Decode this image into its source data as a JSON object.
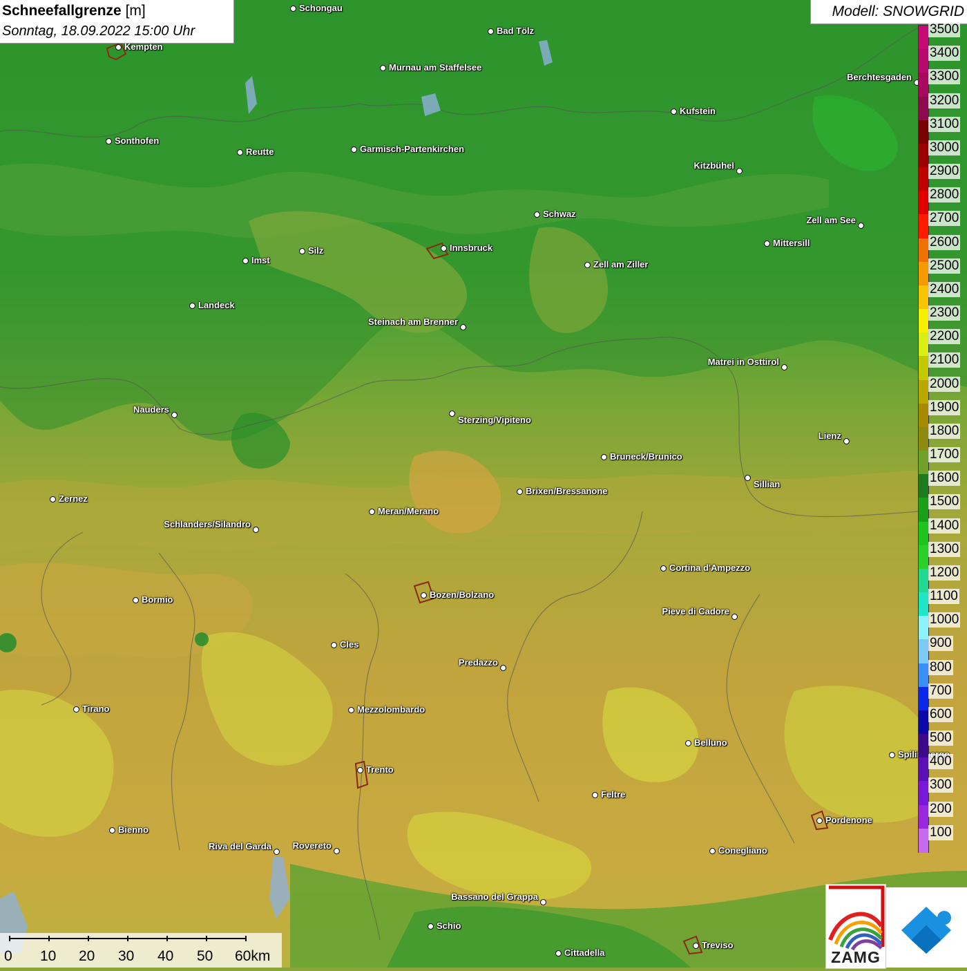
{
  "header": {
    "title_bold": "Schneefallgrenze",
    "title_unit": " [m]",
    "datetime": "Sonntag, 18.09.2022 15:00 Uhr",
    "model": "Modell: SNOWGRID"
  },
  "legend": {
    "levels": [
      "3500",
      "3400",
      "3300",
      "3200",
      "3100",
      "3000",
      "2900",
      "2800",
      "2700",
      "2600",
      "2500",
      "2400",
      "2300",
      "2200",
      "2100",
      "2000",
      "1900",
      "1800",
      "1700",
      "1600",
      "1500",
      "1400",
      "1300",
      "1200",
      "1100",
      "1000",
      "900",
      "800",
      "700",
      "600",
      "500",
      "400",
      "300",
      "200",
      "100"
    ],
    "colors": [
      "#c40a74",
      "#b80a6e",
      "#a8085e",
      "#8e0a4c",
      "#7a0000",
      "#9c0000",
      "#c00000",
      "#e00000",
      "#ff1a00",
      "#f07000",
      "#f59a00",
      "#f8c400",
      "#f6f000",
      "#d8ee14",
      "#c4c800",
      "#b8a800",
      "#a88a00",
      "#8e8a10",
      "#6ea02a",
      "#1e7a1e",
      "#18a018",
      "#1ec41e",
      "#2ad02a",
      "#20d890",
      "#20e6c8",
      "#8ef2ff",
      "#7ec8f8",
      "#3a8ef8",
      "#0a28e8",
      "#0a0aa8",
      "#3a0a8a",
      "#5a10b4",
      "#7a18d8",
      "#9a28e0",
      "#c86af0"
    ]
  },
  "cities": [
    {
      "name": "Schongau"
    },
    {
      "name": "Bad Tölz"
    },
    {
      "name": "Kempten"
    },
    {
      "name": "Murnau am Staffelsee"
    },
    {
      "name": "Berchtesgaden"
    },
    {
      "name": "Kufstein"
    },
    {
      "name": "Sonthofen"
    },
    {
      "name": "Reutte"
    },
    {
      "name": "Garmisch-Partenkirchen"
    },
    {
      "name": "Kitzbühel"
    },
    {
      "name": "Schwaz"
    },
    {
      "name": "Zell am See"
    },
    {
      "name": "Innsbruck"
    },
    {
      "name": "Mittersill"
    },
    {
      "name": "Imst"
    },
    {
      "name": "Silz"
    },
    {
      "name": "Zell am Ziller"
    },
    {
      "name": "Landeck"
    },
    {
      "name": "Steinach am Brenner"
    },
    {
      "name": "Matrei in Osttirol"
    },
    {
      "name": "Nauders"
    },
    {
      "name": "Sterzing/Vipiteno"
    },
    {
      "name": "Lienz"
    },
    {
      "name": "Bruneck/Brunico"
    },
    {
      "name": "Sillian"
    },
    {
      "name": "Zernez"
    },
    {
      "name": "Brixen/Bressanone"
    },
    {
      "name": "Meran/Merano"
    },
    {
      "name": "Schlanders/Silandro"
    },
    {
      "name": "Cortina d'Ampezzo"
    },
    {
      "name": "Bozen/Bolzano"
    },
    {
      "name": "Bormio"
    },
    {
      "name": "Pieve di Cadore"
    },
    {
      "name": "Cles"
    },
    {
      "name": "Predazzo"
    },
    {
      "name": "Tirano"
    },
    {
      "name": "Mezzolombardo"
    },
    {
      "name": "Belluno"
    },
    {
      "name": "Spilimbergo"
    },
    {
      "name": "Trento"
    },
    {
      "name": "Feltre"
    },
    {
      "name": "Pordenone"
    },
    {
      "name": "Bienno"
    },
    {
      "name": "Riva del Garda"
    },
    {
      "name": "Rovereto"
    },
    {
      "name": "Conegliano"
    },
    {
      "name": "Bassano del Grappa"
    },
    {
      "name": "Schio"
    },
    {
      "name": "Treviso"
    },
    {
      "name": "Cittadella"
    }
  ],
  "scale": {
    "ticks": [
      "0",
      "10",
      "20",
      "30",
      "40",
      "50",
      "60km"
    ]
  },
  "logos": {
    "zamg_text": "ZAMG"
  }
}
